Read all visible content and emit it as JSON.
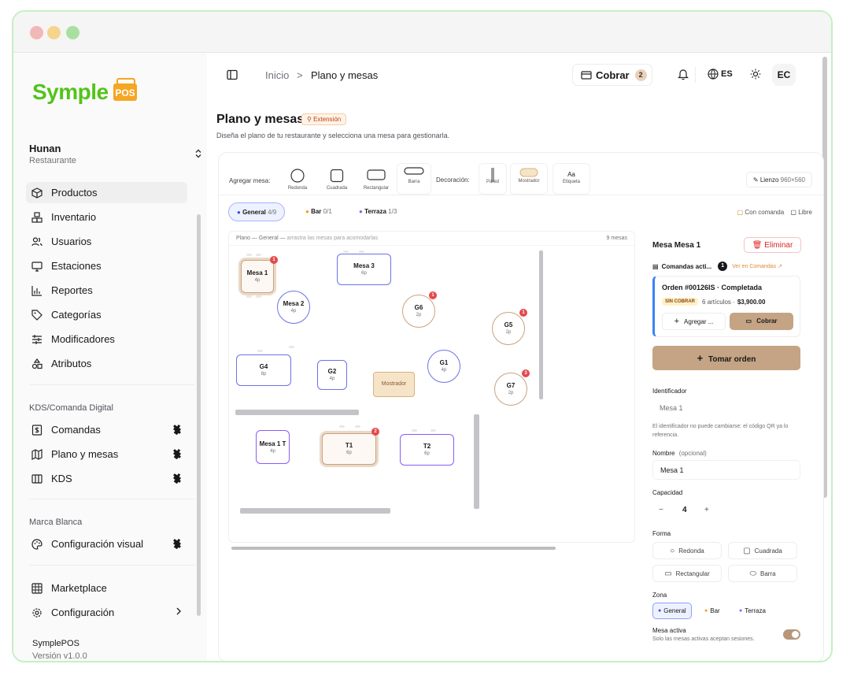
{
  "colors": {
    "brand": "#52c41a",
    "accent": "#c4a484",
    "danger": "#dc2626",
    "zone_general": "#3b4be0",
    "zone_bar": "#f59e0b",
    "zone_terraza": "#8b5cf6"
  },
  "brand": {
    "name": "Symple",
    "badge": "POS"
  },
  "workspace": {
    "name": "Hunan",
    "type": "Restaurante"
  },
  "nav": {
    "main": [
      {
        "label": "Productos",
        "icon": "box-icon"
      },
      {
        "label": "Inventario",
        "icon": "boxes-icon"
      },
      {
        "label": "Usuarios",
        "icon": "users-icon"
      },
      {
        "label": "Estaciones",
        "icon": "monitor-icon"
      },
      {
        "label": "Reportes",
        "icon": "bar-chart-icon"
      },
      {
        "label": "Categorías",
        "icon": "tag-icon"
      },
      {
        "label": "Modificadores",
        "icon": "sliders-icon"
      },
      {
        "label": "Atributos",
        "icon": "shapes-icon"
      }
    ],
    "kds_section": "KDS/Comanda Digital",
    "kds": [
      {
        "label": "Comandas",
        "icon": "receipt-icon"
      },
      {
        "label": "Plano y mesas",
        "icon": "map-icon"
      },
      {
        "label": "KDS",
        "icon": "columns-icon"
      }
    ],
    "brand_section": "Marca Blanca",
    "brand_items": [
      {
        "label": "Configuración visual",
        "icon": "palette-icon"
      }
    ],
    "bottom": [
      {
        "label": "Marketplace",
        "icon": "grid-icon"
      },
      {
        "label": "Configuración",
        "icon": "gear-icon"
      }
    ]
  },
  "footer": {
    "app": "SymplePOS",
    "version": "Versión v1.0.0"
  },
  "topbar": {
    "crumb_home": "Inicio",
    "crumb_sep": ">",
    "crumb_current": "Plano y mesas",
    "cobrar": "Cobrar",
    "cobrar_count": "2",
    "lang": "ES",
    "avatar": "EC"
  },
  "page": {
    "title": "Plano y mesas",
    "badge": "Extensión",
    "subtitle": "Diseña el plano de tu restaurante y selecciona una mesa para gestionarla."
  },
  "toolbar": {
    "add_label": "Agregar mesa:",
    "add_tools": [
      "Redonda",
      "Cuadrada",
      "Rectangular",
      "Barra"
    ],
    "deco_label": "Decoración:",
    "deco_tools": [
      "Pared",
      "Mostrador",
      "Etiqueta"
    ],
    "etiqueta_glyph": "Aa",
    "lienzo": "Lienzo",
    "lienzo_size": "960×560"
  },
  "zones": [
    {
      "name": "General",
      "count": "4/9"
    },
    {
      "name": "Bar",
      "count": "0/1"
    },
    {
      "name": "Terraza",
      "count": "1/3"
    }
  ],
  "legend": {
    "con_comanda": "Con comanda",
    "libre": "Libre"
  },
  "plano": {
    "header": "Plano — General —",
    "hint": "arrastra las mesas para acomodarlas",
    "count": "9 mesas"
  },
  "tables": [
    {
      "name": "Mesa 1",
      "cap": "4p",
      "badge": "1"
    },
    {
      "name": "Mesa 3",
      "cap": "6p",
      "badge": ""
    },
    {
      "name": "Mesa 2",
      "cap": "4p",
      "badge": ""
    },
    {
      "name": "G6",
      "cap": "2p",
      "badge": "1"
    },
    {
      "name": "G5",
      "cap": "2p",
      "badge": "1"
    },
    {
      "name": "G4",
      "cap": "8p",
      "badge": ""
    },
    {
      "name": "G2",
      "cap": "4p",
      "badge": ""
    },
    {
      "name": "Mostrador",
      "cap": "",
      "badge": ""
    },
    {
      "name": "G1",
      "cap": "4p",
      "badge": ""
    },
    {
      "name": "G7",
      "cap": "2p",
      "badge": "3"
    },
    {
      "name": "Mesa 1 T",
      "cap": "4p",
      "badge": ""
    },
    {
      "name": "T1",
      "cap": "6p",
      "badge": "2"
    },
    {
      "name": "T2",
      "cap": "6p",
      "badge": ""
    }
  ],
  "panel": {
    "title": "Mesa Mesa 1",
    "delete": "Eliminar",
    "comandas": "Comandas acti...",
    "comandas_count": "1",
    "ver": "Ver en Comandas ↗",
    "order_title": "Orden #00126IS · Completada",
    "sin_cobrar": "SIN COBRAR",
    "articulos": "6 artículos ·",
    "total": "$3,900.00",
    "agregar": "Agregar ...",
    "cobrar": "Cobrar",
    "tomar": "Tomar orden",
    "id_label": "Identificador",
    "id_value": "Mesa 1",
    "id_hint": "El identificador no puede cambiarse: el código QR ya lo referencia.",
    "nombre_label": "Nombre",
    "nombre_opt": "(opcional)",
    "nombre_value": "Mesa 1",
    "cap_label": "Capacidad",
    "cap_minus": "−",
    "cap_value": "4",
    "cap_plus": "+",
    "forma_label": "Forma",
    "formas": [
      "Redonda",
      "Cuadrada",
      "Rectangular",
      "Barra"
    ],
    "zona_label": "Zona",
    "zonas": [
      "General",
      "Bar",
      "Terraza"
    ],
    "activa_label": "Mesa activa",
    "activa_hint": "Solo las mesas activas aceptan sesiones."
  }
}
